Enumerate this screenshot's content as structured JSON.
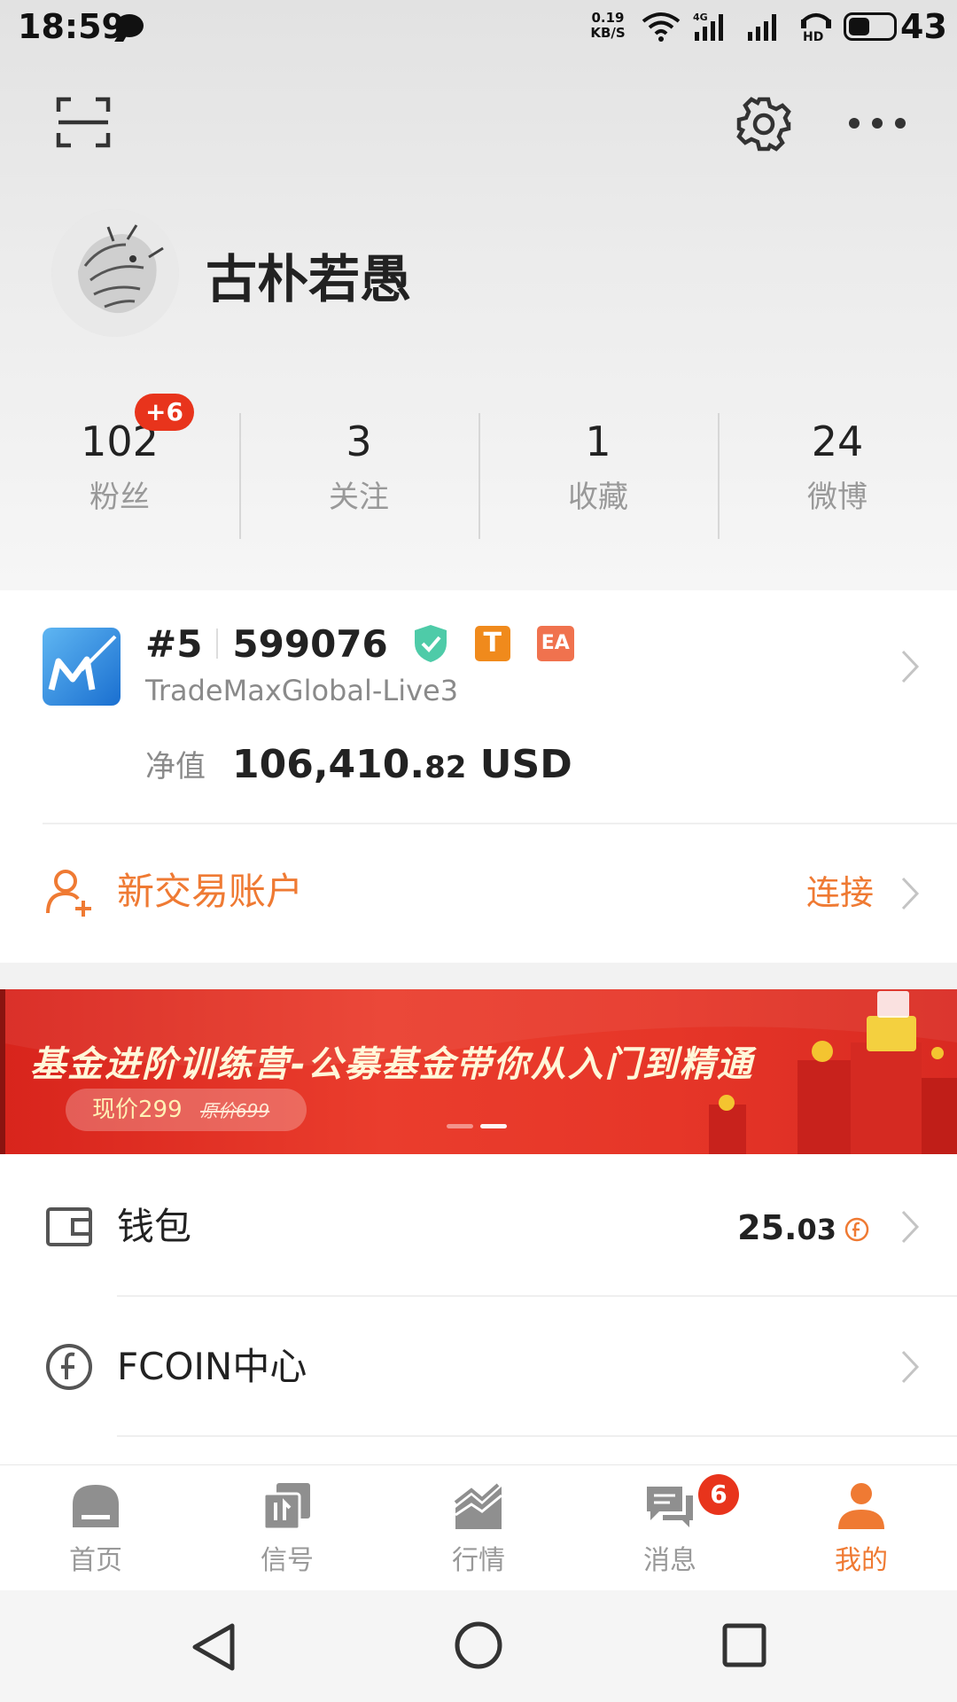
{
  "status_bar": {
    "time": "18:59",
    "net_speed_value": "0.19",
    "net_speed_unit": "KB/S",
    "network_label": "4G",
    "hd_label": "HD",
    "battery_level": "43",
    "battery_fraction": 0.43
  },
  "profile": {
    "username": "古朴若愚",
    "stats": [
      {
        "value": "102",
        "label": "粉丝",
        "badge": "+6"
      },
      {
        "value": "3",
        "label": "关注"
      },
      {
        "value": "1",
        "label": "收藏"
      },
      {
        "value": "24",
        "label": "微博"
      }
    ]
  },
  "account": {
    "rank": "#5",
    "number": "599076",
    "badge_t": "T",
    "badge_ea": "EA",
    "server": "TradeMaxGlobal-Live3",
    "equity_label": "净值",
    "equity_main": "106,410.",
    "equity_cents": "82",
    "equity_currency": "USD"
  },
  "new_account": {
    "label": "新交易账户",
    "action": "连接"
  },
  "banner": {
    "title": "基金进阶训练营-公募基金带你从入门到精通",
    "price": "现价299",
    "original_price": "原价699"
  },
  "menu": {
    "wallet_label": "钱包",
    "wallet_value_main": "25.",
    "wallet_value_cents": "03",
    "fcoin_label": "FCOIN中心"
  },
  "tabs": [
    {
      "label": "首页"
    },
    {
      "label": "信号"
    },
    {
      "label": "行情"
    },
    {
      "label": "消息",
      "badge": "6"
    },
    {
      "label": "我的"
    }
  ],
  "colors": {
    "accent": "#ef7a33",
    "badge_red": "#e8341c",
    "verified_green": "#4ecba8",
    "banner_red": "#e63628"
  }
}
